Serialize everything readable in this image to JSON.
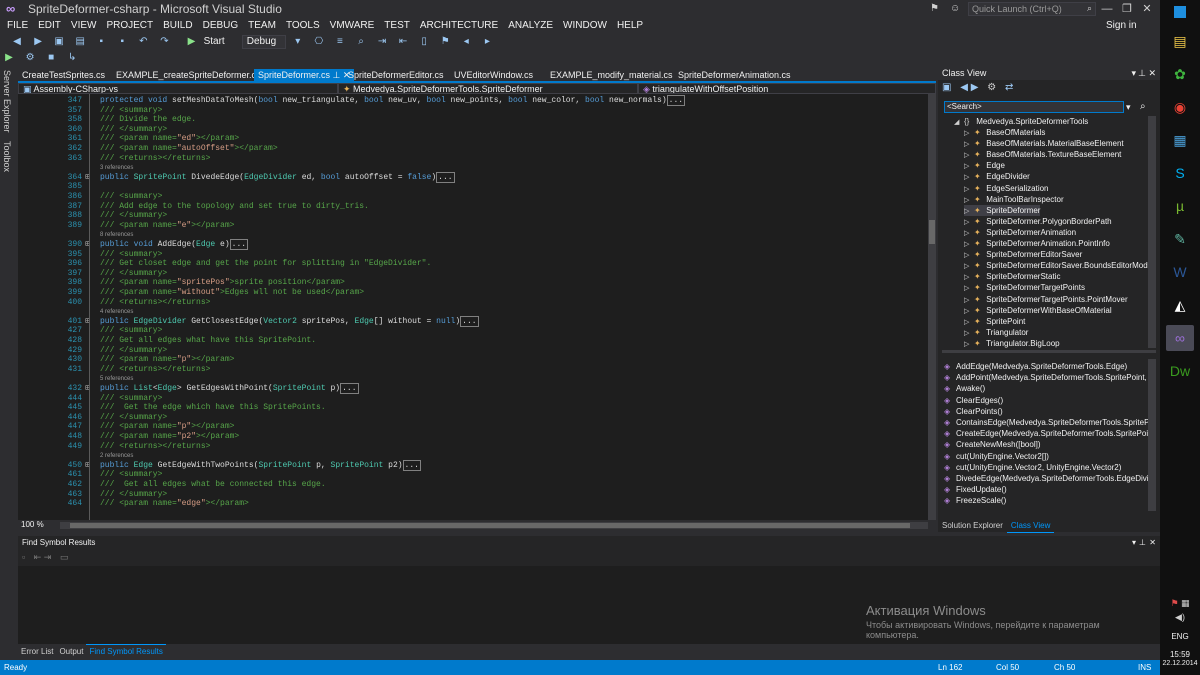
{
  "window": {
    "title": "SpriteDeformer-csharp - Microsoft Visual Studio",
    "sign_in": "Sign in",
    "quick_launch_placeholder": "Quick Launch (Ctrl+Q)",
    "controls": {
      "minimize": "—",
      "restore": "❐",
      "close": "✕"
    }
  },
  "menu": [
    "FILE",
    "EDIT",
    "VIEW",
    "PROJECT",
    "BUILD",
    "DEBUG",
    "TEAM",
    "TOOLS",
    "VMWARE",
    "TEST",
    "ARCHITECTURE",
    "ANALYZE",
    "WINDOW",
    "HELP"
  ],
  "toolbar": {
    "start_label": "Start",
    "config_value": "Debug"
  },
  "side_tabs": [
    "Server Explorer",
    "Toolbox"
  ],
  "doc_tabs": [
    {
      "label": "CreateTestSprites.cs",
      "active": false
    },
    {
      "label": "EXAMPLE_createSpriteDeformer.cs",
      "active": false
    },
    {
      "label": "SpriteDeformer.cs",
      "active": true
    },
    {
      "label": "SpriteDeformerEditor.cs",
      "active": false
    },
    {
      "label": "UVEditorWindow.cs",
      "active": false
    },
    {
      "label": "EXAMPLE_modify_material.cs",
      "active": false
    },
    {
      "label": "SpriteDeformerAnimation.cs",
      "active": false
    }
  ],
  "nav": {
    "project": "Assembly-CSharp-vs",
    "type": "Medvedya.SpriteDeformerTools.SpriteDeformer",
    "member": "triangulateWithOffsetPosition"
  },
  "code_lines": [
    {
      "n": "347",
      "html": "<span class=\"kw\">protected void</span> <span class=\"tx\">setMeshDataToMesh(</span><span class=\"kw\">bool</span> <span class=\"tx\">new_triangulate,</span> <span class=\"kw\">bool</span> <span class=\"tx\">new_uv,</span> <span class=\"kw\">bool</span> <span class=\"tx\">new_points,</span> <span class=\"kw\">bool</span> <span class=\"tx\">new_color,</span> <span class=\"kw\">bool</span> <span class=\"tx\">new_normals)</span><span class=\"collapsed\">...</span>",
      "fold": ""
    },
    {
      "n": "357",
      "html": "<span class=\"cm\">/// &lt;summary&gt;</span>",
      "fold": ""
    },
    {
      "n": "358",
      "html": "<span class=\"cm\">/// Divide the edge.</span>",
      "fold": ""
    },
    {
      "n": "360",
      "html": "<span class=\"cm\">/// &lt;/summary&gt;</span>",
      "fold": ""
    },
    {
      "n": "361",
      "html": "<span class=\"cm\">/// &lt;param name=</span><span class=\"st\">\"ed\"</span><span class=\"cm\">&gt;&lt;/param&gt;</span>",
      "fold": ""
    },
    {
      "n": "362",
      "html": "<span class=\"cm\">/// &lt;param name=</span><span class=\"st\">\"autoOffset\"</span><span class=\"cm\">&gt;&lt;/param&gt;</span>",
      "fold": ""
    },
    {
      "n": "363",
      "html": "<span class=\"cm\">/// &lt;returns&gt;&lt;/returns&gt;</span>",
      "fold": ""
    },
    {
      "n": "",
      "html": "<span class=\"refs\">3 references</span>",
      "fold": ""
    },
    {
      "n": "364",
      "html": "<span class=\"kw\">public</span> <span class=\"ty\">SpritePoint</span> <span class=\"tx\">DivedeEdge(</span><span class=\"ty\">EdgeDivider</span> <span class=\"tx\">ed,</span> <span class=\"kw\">bool</span> <span class=\"tx\">autoOffset = </span><span class=\"kw\">false</span><span class=\"tx\">)</span><span class=\"collapsed\">...</span>",
      "fold": "+"
    },
    {
      "n": "385",
      "html": "",
      "fold": ""
    },
    {
      "n": "386",
      "html": "<span class=\"cm\">/// &lt;summary&gt;</span>",
      "fold": ""
    },
    {
      "n": "387",
      "html": "<span class=\"cm\">/// Add edge to the topology and set true to dirty_tris.</span>",
      "fold": ""
    },
    {
      "n": "388",
      "html": "<span class=\"cm\">/// &lt;/summary&gt;</span>",
      "fold": ""
    },
    {
      "n": "389",
      "html": "<span class=\"cm\">/// &lt;param name=</span><span class=\"st\">\"e\"</span><span class=\"cm\">&gt;&lt;/param&gt;</span>",
      "fold": ""
    },
    {
      "n": "",
      "html": "<span class=\"refs\">8 references</span>",
      "fold": ""
    },
    {
      "n": "390",
      "html": "<span class=\"kw\">public void</span> <span class=\"tx\">AddEdge(</span><span class=\"ty\">Edge</span> <span class=\"tx\">e)</span><span class=\"collapsed\">...</span>",
      "fold": "+"
    },
    {
      "n": "395",
      "html": "<span class=\"cm\">/// &lt;summary&gt;</span>",
      "fold": ""
    },
    {
      "n": "396",
      "html": "<span class=\"cm\">/// Get closet edge and get the point for splitting in \"EdgeDivider\".</span>",
      "fold": ""
    },
    {
      "n": "397",
      "html": "<span class=\"cm\">/// &lt;/summary&gt;</span>",
      "fold": ""
    },
    {
      "n": "398",
      "html": "<span class=\"cm\">/// &lt;param name=</span><span class=\"st\">\"spritePos\"</span><span class=\"cm\">&gt;sprite position&lt;/param&gt;</span>",
      "fold": ""
    },
    {
      "n": "399",
      "html": "<span class=\"cm\">/// &lt;param name=</span><span class=\"st\">\"without\"</span><span class=\"cm\">&gt;Edges wll not be used&lt;/param&gt;</span>",
      "fold": ""
    },
    {
      "n": "400",
      "html": "<span class=\"cm\">/// &lt;returns&gt;&lt;/returns&gt;</span>",
      "fold": ""
    },
    {
      "n": "",
      "html": "<span class=\"refs\">4 references</span>",
      "fold": ""
    },
    {
      "n": "401",
      "html": "<span class=\"kw\">public</span> <span class=\"ty\">EdgeDivider</span> <span class=\"tx\">GetClosestEdge(</span><span class=\"ty\">Vector2</span> <span class=\"tx\">spritePos,</span> <span class=\"ty\">Edge</span><span class=\"tx\">[] without = </span><span class=\"kw\">null</span><span class=\"tx\">)</span><span class=\"collapsed\">...</span>",
      "fold": "+"
    },
    {
      "n": "427",
      "html": "<span class=\"cm\">/// &lt;summary&gt;</span>",
      "fold": ""
    },
    {
      "n": "428",
      "html": "<span class=\"cm\">/// Get all edges what have this SpritePoint.</span>",
      "fold": ""
    },
    {
      "n": "429",
      "html": "<span class=\"cm\">/// &lt;/summary&gt;</span>",
      "fold": ""
    },
    {
      "n": "430",
      "html": "<span class=\"cm\">/// &lt;param name=</span><span class=\"st\">\"p\"</span><span class=\"cm\">&gt;&lt;/param&gt;</span>",
      "fold": ""
    },
    {
      "n": "431",
      "html": "<span class=\"cm\">/// &lt;returns&gt;&lt;/returns&gt;</span>",
      "fold": ""
    },
    {
      "n": "",
      "html": "<span class=\"refs\">5 references</span>",
      "fold": ""
    },
    {
      "n": "432",
      "html": "<span class=\"kw\">public</span> <span class=\"ty\">List</span><span class=\"tx\">&lt;</span><span class=\"ty\">Edge</span><span class=\"tx\">&gt; GetEdgesWithPoint(</span><span class=\"ty\">SpritePoint</span> <span class=\"tx\">p)</span><span class=\"collapsed\">...</span>",
      "fold": "+"
    },
    {
      "n": "444",
      "html": "<span class=\"cm\">/// &lt;summary&gt;</span>",
      "fold": ""
    },
    {
      "n": "445",
      "html": "<span class=\"cm\">///  Get the edge which have this SpritePoints.</span>",
      "fold": ""
    },
    {
      "n": "446",
      "html": "<span class=\"cm\">/// &lt;/summary&gt;</span>",
      "fold": ""
    },
    {
      "n": "447",
      "html": "<span class=\"cm\">/// &lt;param name=</span><span class=\"st\">\"p\"</span><span class=\"cm\">&gt;&lt;/param&gt;</span>",
      "fold": ""
    },
    {
      "n": "448",
      "html": "<span class=\"cm\">/// &lt;param name=</span><span class=\"st\">\"p2\"</span><span class=\"cm\">&gt;&lt;/param&gt;</span>",
      "fold": ""
    },
    {
      "n": "449",
      "html": "<span class=\"cm\">/// &lt;returns&gt;&lt;/returns&gt;</span>",
      "fold": ""
    },
    {
      "n": "",
      "html": "<span class=\"refs\">2 references</span>",
      "fold": ""
    },
    {
      "n": "450",
      "html": "<span class=\"kw\">public</span> <span class=\"ty\">Edge</span> <span class=\"tx\">GetEdgeWithTwoPoints(</span><span class=\"ty\">SpritePoint</span> <span class=\"tx\">p,</span> <span class=\"ty\">SpritePoint</span> <span class=\"tx\">p2)</span><span class=\"collapsed\">...</span>",
      "fold": "+"
    },
    {
      "n": "461",
      "html": "<span class=\"cm\">/// &lt;summary&gt;</span>",
      "fold": ""
    },
    {
      "n": "462",
      "html": "<span class=\"cm\">///  Get all edges what be connected this edge.</span>",
      "fold": ""
    },
    {
      "n": "463",
      "html": "<span class=\"cm\">/// &lt;/summary&gt;</span>",
      "fold": ""
    },
    {
      "n": "464",
      "html": "<span class=\"cm\">/// &lt;param name=</span><span class=\"st\">\"edge\"</span><span class=\"cm\">&gt;&lt;/param&gt;</span>",
      "fold": ""
    }
  ],
  "editor_status": {
    "zoom": "100 %"
  },
  "class_view": {
    "title": "Class View",
    "search_placeholder": "<Search>",
    "namespace": "Medvedya.SpriteDeformerTools",
    "types": [
      "BaseOfMaterials",
      "BaseOfMaterials.MaterialBaseElement",
      "BaseOfMaterials.TextureBaseElement",
      "Edge",
      "EdgeDivider",
      "EdgeSerialization",
      "MainToolBarInspector",
      "SpriteDeformer",
      "SpriteDeformer.PolygonBorderPath",
      "SpriteDeformerAnimation",
      "SpriteDeformerAnimation.PointInfo",
      "SpriteDeformerEditorSaver",
      "SpriteDeformerEditorSaver.BoundsEditorMode",
      "SpriteDeformerStatic",
      "SpriteDeformerTargetPoints",
      "SpriteDeformerTargetPoints.PointMover",
      "SpriteDeformerWithBaseOfMaterial",
      "SpritePoint",
      "Triangulator",
      "Triangulator.BigLoop"
    ],
    "selected_type": "SpriteDeformer",
    "members": [
      "AddEdge(Medvedya.SpriteDeformerTools.Edge)",
      "AddPoint(Medvedya.SpriteDeformerTools.SpritePoint, b",
      "Awake()",
      "ClearEdges()",
      "ClearPoints()",
      "ContainsEdge(Medvedya.SpriteDeformerTools.SpritePo",
      "CreateEdge(Medvedya.SpriteDeformerTools.SpritePoin",
      "CreateNewMesh([bool])",
      "cut(UnityEngine.Vector2[])",
      "cut(UnityEngine.Vector2, UnityEngine.Vector2)",
      "DivedeEdge(Medvedya.SpriteDeformerTools.EdgeDivid",
      "FixedUpdate()",
      "FreezeScale()"
    ],
    "tabs": [
      "Solution Explorer",
      "Class View"
    ]
  },
  "find_panel": {
    "title": "Find Symbol Results"
  },
  "bottom_tabs": [
    "Error List",
    "Output",
    "Find Symbol Results"
  ],
  "status": {
    "ready": "Ready",
    "ln": "Ln 162",
    "col": "Col 50",
    "ch": "Ch 50",
    "ins": "INS"
  },
  "watermark": {
    "title": "Активация Windows",
    "line1": "Чтобы активировать Windows, перейдите к параметрам",
    "line2": "компьютера."
  },
  "taskbar": {
    "lang": "ENG",
    "time": "15:59",
    "date": "22.12.2014",
    "apps": [
      {
        "name": "file-explorer-icon",
        "glyph": "▤",
        "color": "#f0c94a"
      },
      {
        "name": "icq-icon",
        "glyph": "✿",
        "color": "#3fb43f"
      },
      {
        "name": "chrome-icon",
        "glyph": "◉",
        "color": "#e94235"
      },
      {
        "name": "store-icon",
        "glyph": "▦",
        "color": "#4a9fd8"
      },
      {
        "name": "skype-icon",
        "glyph": "S",
        "color": "#00aff0"
      },
      {
        "name": "utorrent-icon",
        "glyph": "µ",
        "color": "#78b830"
      },
      {
        "name": "notes-icon",
        "glyph": "✎",
        "color": "#5fb4a0"
      },
      {
        "name": "word-icon",
        "glyph": "W",
        "color": "#2b5797"
      },
      {
        "name": "unity-icon",
        "glyph": "◭",
        "color": "#ffffff"
      },
      {
        "name": "visual-studio-icon",
        "glyph": "∞",
        "color": "#9b6fd6"
      },
      {
        "name": "dreamweaver-icon",
        "glyph": "Dw",
        "color": "#3a9b1f"
      }
    ]
  }
}
